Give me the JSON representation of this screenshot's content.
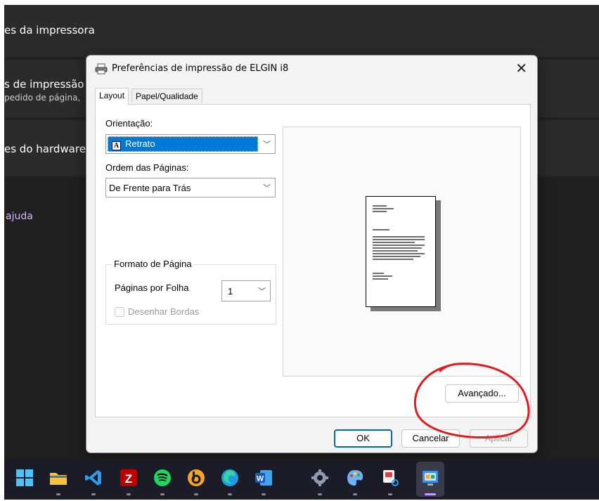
{
  "background": {
    "rows": [
      {
        "text": "es da impressora"
      },
      {
        "text": "s de impressão",
        "subtext": "pedido de página,"
      },
      {
        "text": "es do hardware"
      }
    ],
    "link": "ajuda",
    "colors": {
      "bg": "#202020",
      "row": "#2b2b2b",
      "link": "#d9b6ff"
    }
  },
  "dialog": {
    "title": "Preferências de impressão de ELGIN i8",
    "title_icon": "printer-icon",
    "close_glyph": "✕",
    "tabs": [
      {
        "label": "Layout",
        "active": true
      },
      {
        "label": "Papel/Qualidade",
        "active": false
      }
    ],
    "orientation": {
      "label": "Orientação:",
      "value": "Retrato",
      "icon": "portrait-doc-icon",
      "glyph": "A"
    },
    "page_order": {
      "label": "Ordem das Páginas:",
      "value": "De Frente para Trás"
    },
    "page_format": {
      "title": "Formato de Página",
      "pages_per_sheet_label": "Páginas por Folha",
      "pages_per_sheet_value": "1",
      "draw_borders_label": "Desenhar Bordas",
      "draw_borders_checked": false
    },
    "buttons": {
      "advanced": "Avançado...",
      "ok": "OK",
      "cancel": "Cancelar",
      "apply": "Aplicar"
    },
    "chevron_glyph": "﹀",
    "accent": "#0078d7"
  },
  "taskbar": {
    "apps": [
      "windows-start-icon",
      "file-explorer-icon",
      "vscode-icon",
      "filezilla-icon",
      "spotify-icon",
      "browser-b-icon",
      "edge-icon",
      "word-icon",
      "settings-gear-icon",
      "paint-icon",
      "snipping-tool-icon",
      "control-panel-icon"
    ],
    "filezilla_glyph": "Z",
    "word_glyph": "W"
  }
}
